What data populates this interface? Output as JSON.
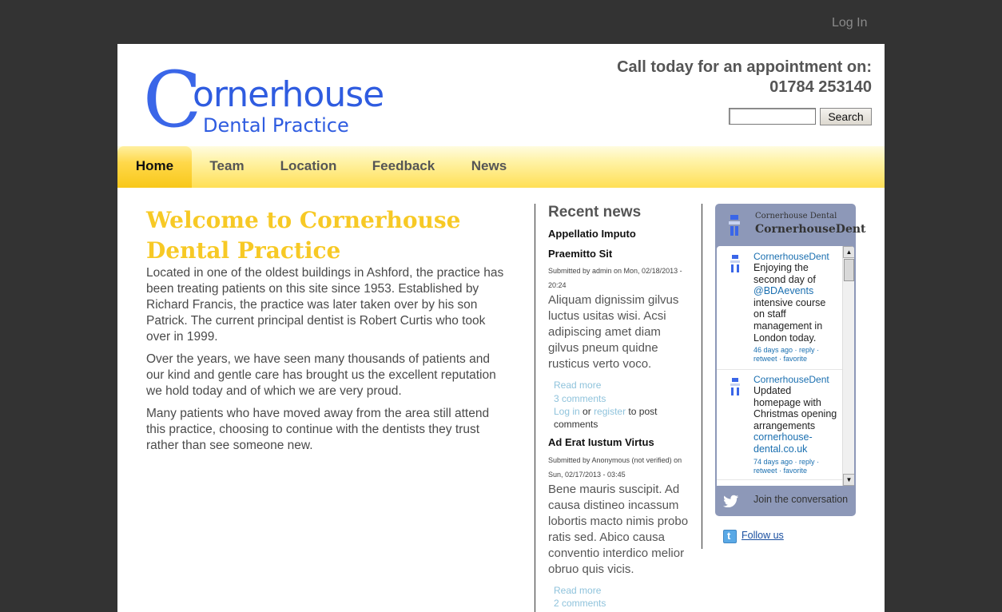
{
  "topbar": {
    "login_label": "Log In"
  },
  "header": {
    "logo_letter": "C",
    "logo_word": "ornerhouse",
    "logo_subtitle": "Dental Practice",
    "cta_line1": "Call today for an appointment on:",
    "cta_phone": "01784 253140"
  },
  "search": {
    "value": "",
    "button_label": "Search"
  },
  "nav": {
    "items": [
      {
        "label": "Home",
        "active": true
      },
      {
        "label": "Team"
      },
      {
        "label": "Location"
      },
      {
        "label": "Feedback"
      },
      {
        "label": "News"
      }
    ]
  },
  "main": {
    "title": "Welcome to Cornerhouse Dental Practice",
    "paragraphs": [
      "Located in one of the oldest buildings in Ashford, the practice has been treating patients on this site since 1953. Established by Richard Francis, the practice was later taken over by his son Patrick. The current principal dentist is Robert Curtis who took over in 1999.",
      "Over the years, we have seen many thousands of patients and our kind and gentle care has brought us the excellent reputation we hold today and of which we are very proud.",
      "Many patients who have moved away from the area still attend this practice, choosing to continue with the dentists they trust rather than see someone new."
    ]
  },
  "recent_news": {
    "heading": "Recent news",
    "items": [
      {
        "title_line1": "Appellatio Imputo",
        "title_line2": "Praemitto Sit",
        "meta": "Submitted by admin on Mon, 02/18/2013 - 20:24",
        "body": "Aliquam dignissim gilvus luctus usitas wisi. Acsi adipiscing amet diam gilvus pneum quidne rusticus verto voco.",
        "read_more": "Read more",
        "comments": "3 comments",
        "login_link": "Log in",
        "or_text": "or",
        "register_link": "register",
        "post_text": "to post comments"
      },
      {
        "title_line1": "Ad Erat Iustum Virtus",
        "meta": "Submitted by Anonymous (not verified) on Sun, 02/17/2013 - 03:45",
        "body": "Bene mauris suscipit. Ad causa distineo incassum lobortis macto nimis probo ratis sed. Abico causa conventio interdico melior obruo quis vicis.",
        "read_more": "Read more",
        "comments": "2 comments"
      }
    ]
  },
  "twitter": {
    "name_small": "Cornerhouse Dental",
    "name_big": "CornerhouseDent",
    "tweets": [
      {
        "user": "CornerhouseDent",
        "text_before": "Enjoying the second day of ",
        "mention": "@BDAevents",
        "text_after": " intensive course on staff management in London today.",
        "time": "46 days ago",
        "reply": "reply",
        "retweet": "retweet",
        "favorite": "favorite"
      },
      {
        "user": "CornerhouseDent",
        "text_before": "Updated homepage with Christmas opening arrangements ",
        "mention": "cornerhouse-dental.co.uk",
        "text_after": "",
        "time": "74 days ago",
        "reply": "reply",
        "retweet": "retweet",
        "favorite": "favorite"
      }
    ],
    "join_label": "Join the conversation",
    "follow_label": "Follow us"
  },
  "colors": {
    "page_bg": "#333333",
    "brand_blue": "#2f5ce0",
    "nav_yellow": "#ffdf55",
    "title_yellow": "#f7c925",
    "link_light_blue": "#8fc3dc",
    "twitter_panel": "#8d98b8"
  }
}
